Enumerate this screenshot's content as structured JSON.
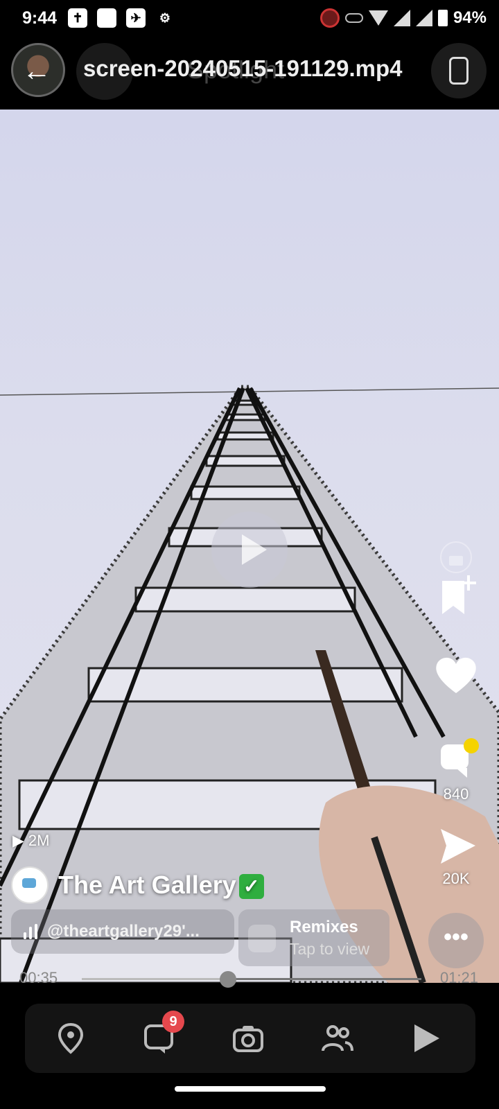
{
  "status_bar": {
    "time": "9:44",
    "battery": "94%",
    "notification_icons": [
      "✝",
      "",
      "✈",
      "⚙"
    ]
  },
  "header": {
    "file_title": "screen-20240515-191129.mp4",
    "ghost_tab": "Spotlight"
  },
  "video": {
    "views": "2M",
    "creator_name": "The Art Gallery",
    "verified_glyph": "✓",
    "sound_handle": "@theartgallery29'...",
    "remix_title": "Remixes",
    "remix_subtitle": "Tap to view",
    "more_label": "•••"
  },
  "actions": {
    "comments_count": "840",
    "shares_count": "20K"
  },
  "playback": {
    "current_time": "00:35",
    "duration": "01:21",
    "progress": 0.43
  },
  "bottom_nav": {
    "chat_badge": "9",
    "items": [
      "map-icon",
      "chat-icon",
      "camera-icon",
      "friends-icon",
      "spotlight-icon"
    ]
  }
}
